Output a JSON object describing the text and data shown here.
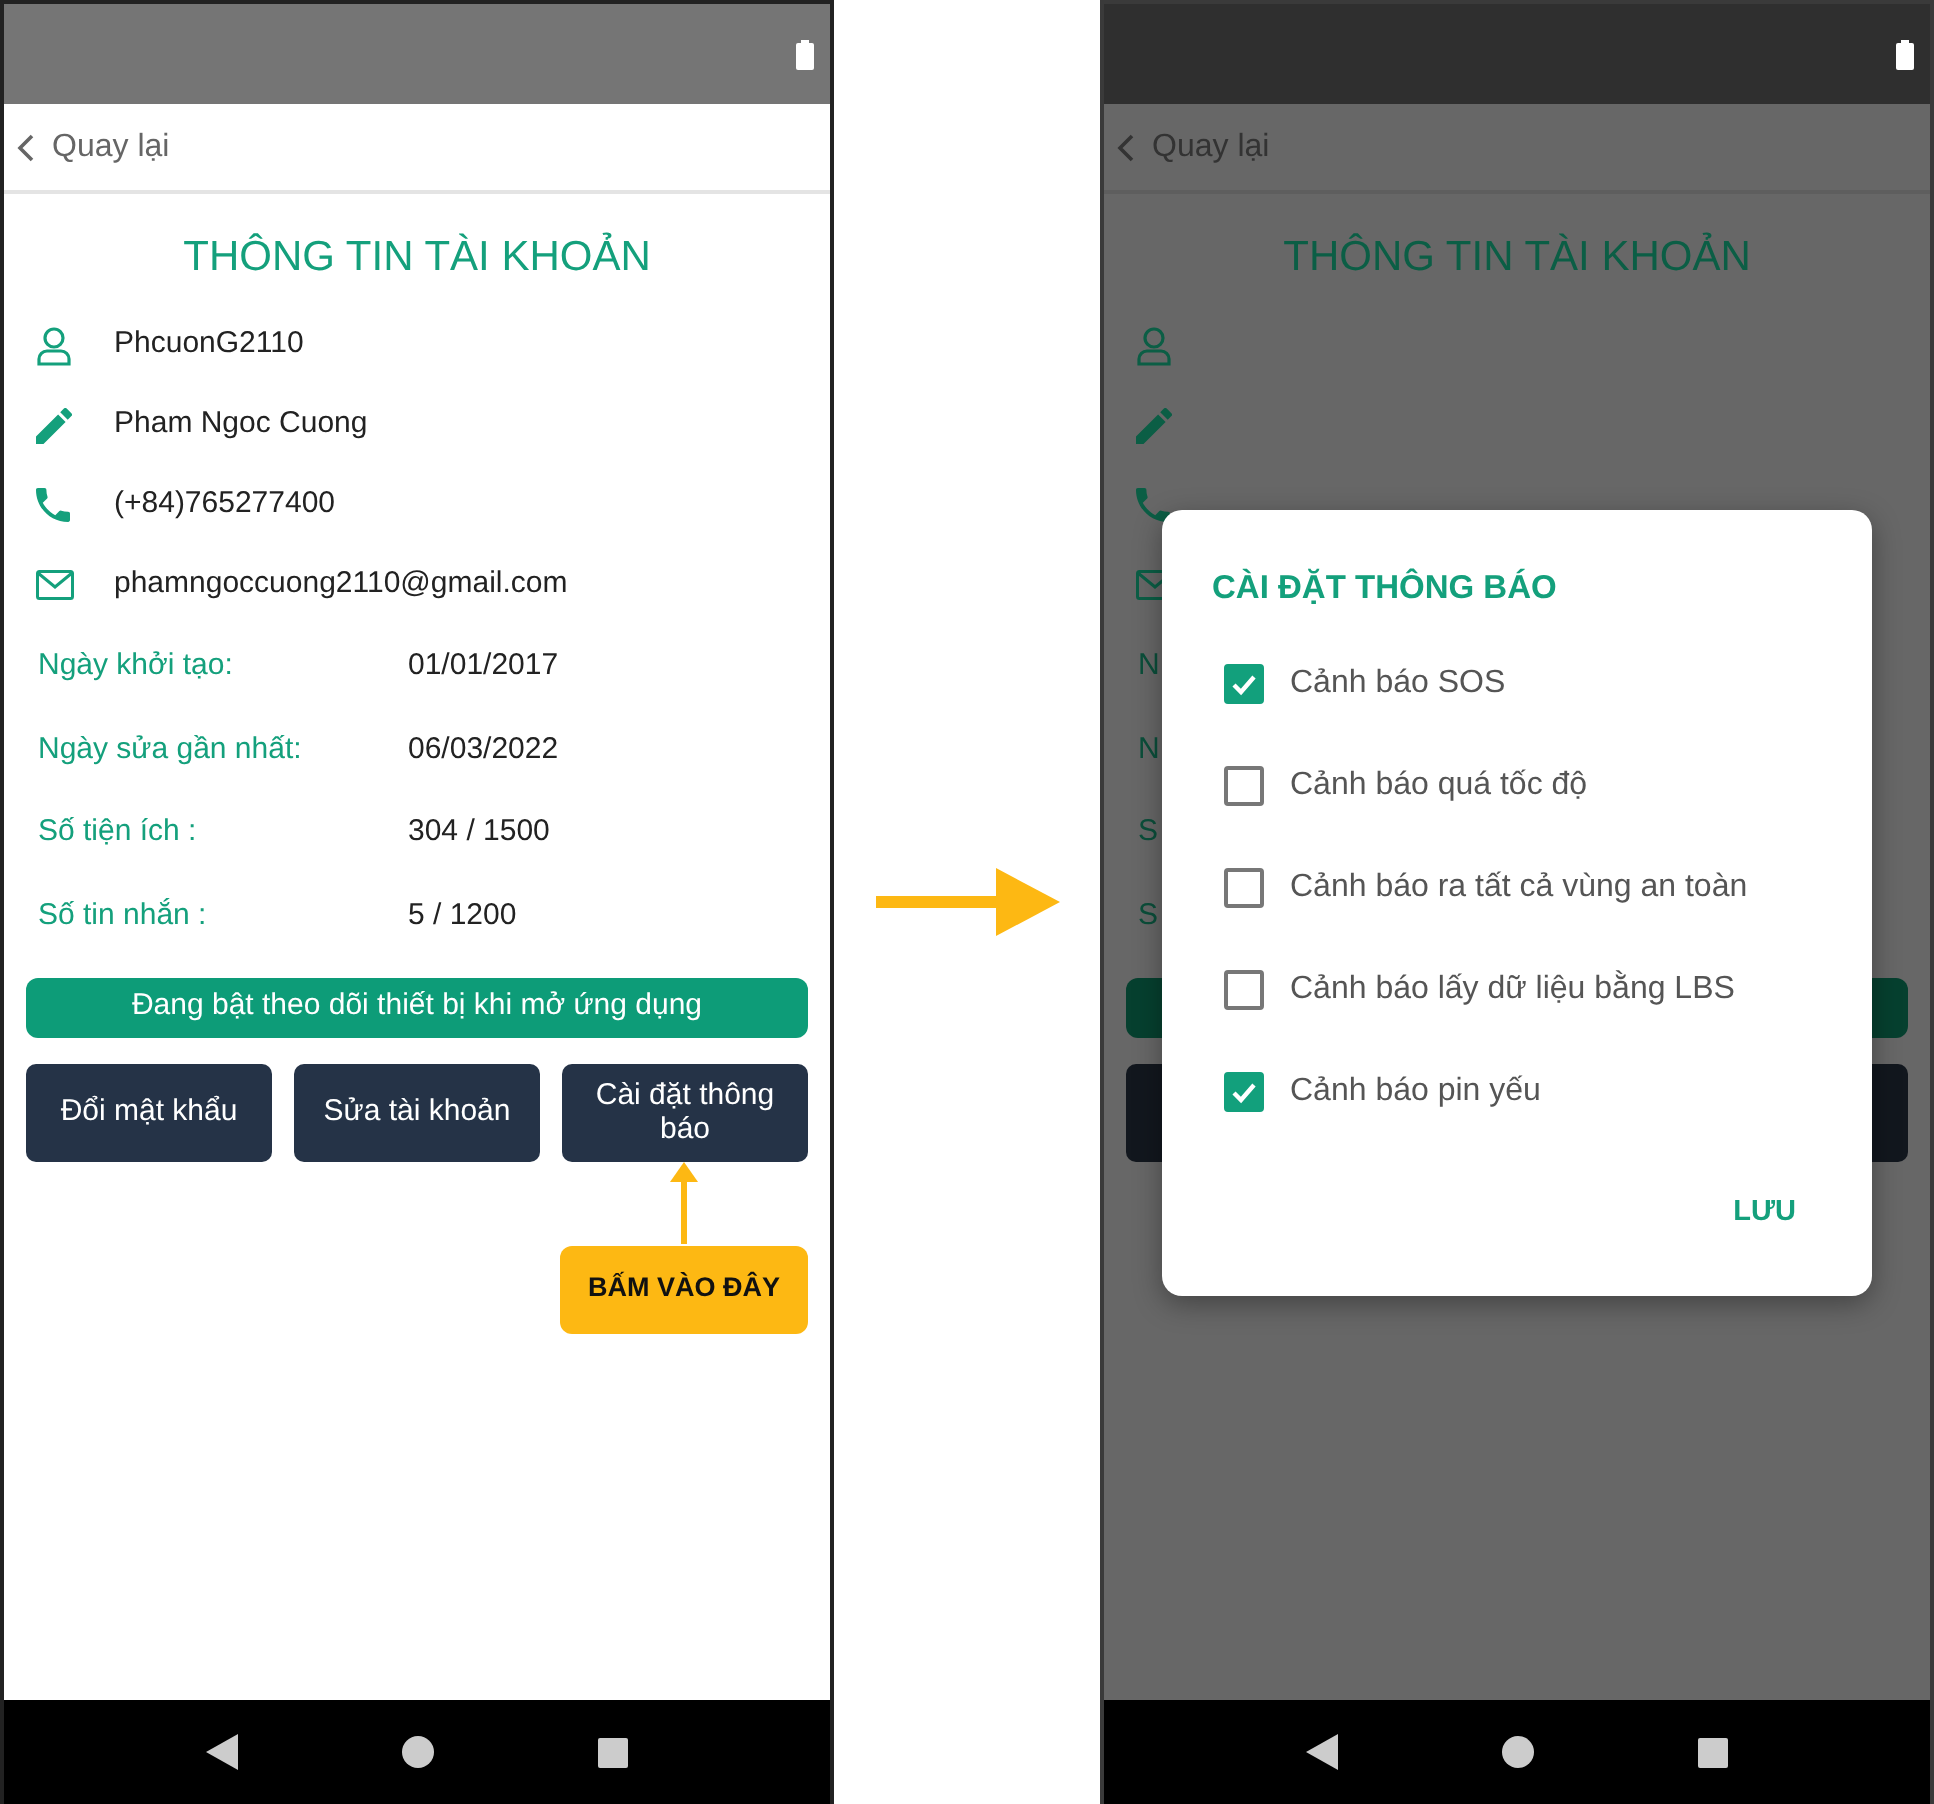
{
  "screens": [
    {
      "kind": "profile",
      "back_label": "Quay lại",
      "title": "THÔNG TIN TÀI KHOẢN",
      "contacts": [
        {
          "kind": "user",
          "text": "PhcuonG2110"
        },
        {
          "kind": "pen",
          "text": "Pham Ngoc Cuong"
        },
        {
          "kind": "phone",
          "text": "(+84)765277400"
        },
        {
          "kind": "mail",
          "text": "phamngoccuong2110@gmail.com"
        }
      ],
      "info": [
        {
          "label": "Ngày khởi tạo:",
          "value": "01/01/2017"
        },
        {
          "label": "Ngày sửa gần nhất:",
          "value": "06/03/2022"
        },
        {
          "label": "Số tiện ích :",
          "value": "304 / 1500"
        },
        {
          "label": "Số tin nhắn :",
          "value": "5 / 1200"
        }
      ],
      "banner": "Đang bật theo dõi thiết bị khi mở ứng dụng",
      "buttons": [
        "Đổi mật khẩu",
        "Sửa tài khoản",
        "Cài đặt thông báo"
      ],
      "callout": "BẤM VÀO ĐÂY"
    },
    {
      "kind": "dialog",
      "back_label": "Quay lại",
      "title": "THÔNG TIN TÀI KHOẢN",
      "contacts": [
        {
          "kind": "user"
        },
        {
          "kind": "pen"
        },
        {
          "kind": "phone"
        },
        {
          "kind": "mail"
        }
      ],
      "info": [
        {
          "label": "N"
        },
        {
          "label": "N"
        },
        {
          "label": "S"
        },
        {
          "label": "S"
        }
      ],
      "dialog": {
        "title": "CÀI ĐẶT THÔNG BÁO",
        "options": [
          {
            "label": "Cảnh báo SOS",
            "checked": true
          },
          {
            "label": "Cảnh báo quá tốc độ",
            "checked": false
          },
          {
            "label": "Cảnh báo ra tất cả vùng an toàn",
            "checked": false
          },
          {
            "label": "Cảnh báo lấy dữ liệu bằng LBS",
            "checked": false
          },
          {
            "label": "Cảnh báo pin yếu",
            "checked": true
          }
        ],
        "save": "LƯU"
      }
    }
  ]
}
